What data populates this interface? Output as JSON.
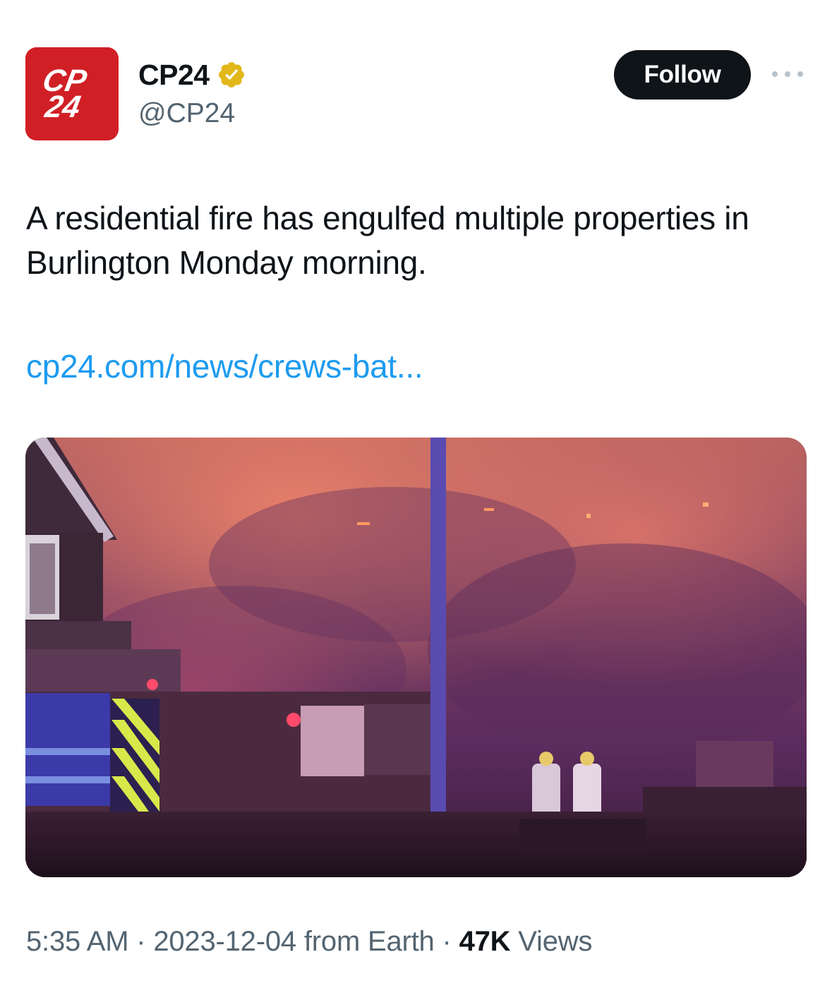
{
  "account": {
    "avatar_text_line1": "CP",
    "avatar_text_line2": "24",
    "display_name": "CP24",
    "handle": "@CP24",
    "verified_badge_color": "#e2b719",
    "avatar_color": "#d11f26"
  },
  "actions": {
    "follow_label": "Follow",
    "more_icon": "more-horizontal-icon"
  },
  "tweet": {
    "text": "A residential fire has engulfed multiple properties in Burlington Monday morning.",
    "link": "cp24.com/news/crews-bat..."
  },
  "meta": {
    "time": "5:35 AM",
    "separator": "·",
    "date": "2023-12-04",
    "source": "from Earth",
    "views_count": "47K",
    "views_label": "Views"
  },
  "colors": {
    "link": "#1d9bf0",
    "secondary_text": "#536471",
    "primary_text": "#0f1419"
  }
}
